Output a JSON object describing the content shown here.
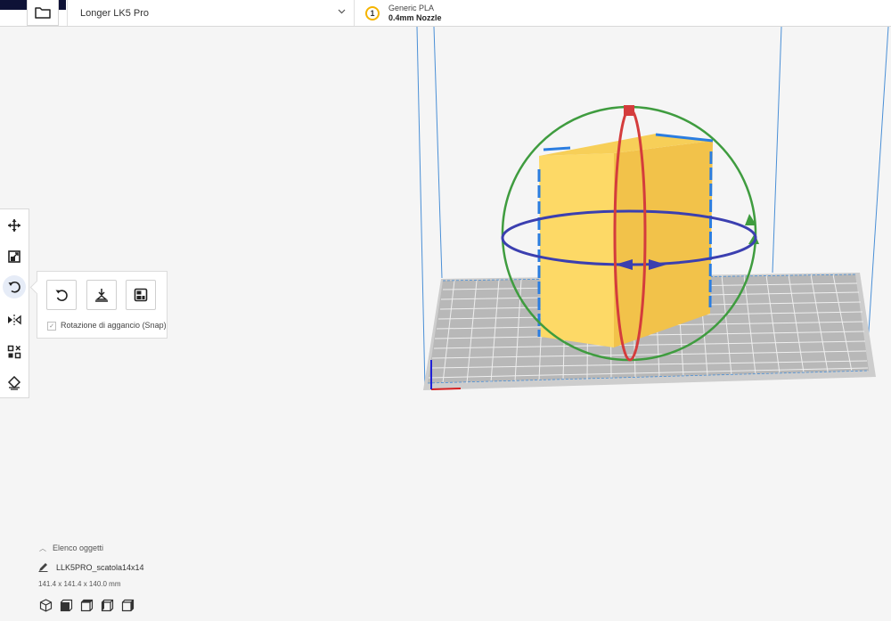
{
  "header": {
    "printer_name": "Longer LK5 Pro",
    "material": {
      "extruder_number": "1",
      "name": "Generic PLA",
      "nozzle": "0.4mm Nozzle",
      "badge_color": "#f5b400"
    }
  },
  "toolbar": {
    "tools": [
      {
        "name": "move",
        "icon": "move-icon"
      },
      {
        "name": "scale",
        "icon": "scale-icon"
      },
      {
        "name": "rotate",
        "icon": "rotate-icon",
        "active": true
      },
      {
        "name": "mirror",
        "icon": "mirror-icon"
      },
      {
        "name": "per-model-settings",
        "icon": "per-model-settings-icon"
      },
      {
        "name": "support-blocker",
        "icon": "support-blocker-icon"
      }
    ]
  },
  "rotate_panel": {
    "buttons": [
      "reset-rotation-icon",
      "lay-flat-icon",
      "select-face-to-align-icon"
    ],
    "snap_label": "Rotazione di aggancio (Snap)",
    "snap_checked": true
  },
  "object_list": {
    "header_label": "Elenco oggetti",
    "object_name": "LLK5PRO_scatola14x14",
    "dimensions": "141.4 x 141.4 x 140.0 mm",
    "view_buttons": [
      "3d-view-icon",
      "front-view-icon",
      "top-view-icon",
      "left-view-icon",
      "right-view-icon"
    ]
  },
  "colors": {
    "model": "#fdd966",
    "model_side": "#f2c24a",
    "ring_x": "#d43c3c",
    "ring_y": "#3f9c3f",
    "ring_z": "#3b3fb0",
    "build_volume": "#4a8fd6"
  }
}
